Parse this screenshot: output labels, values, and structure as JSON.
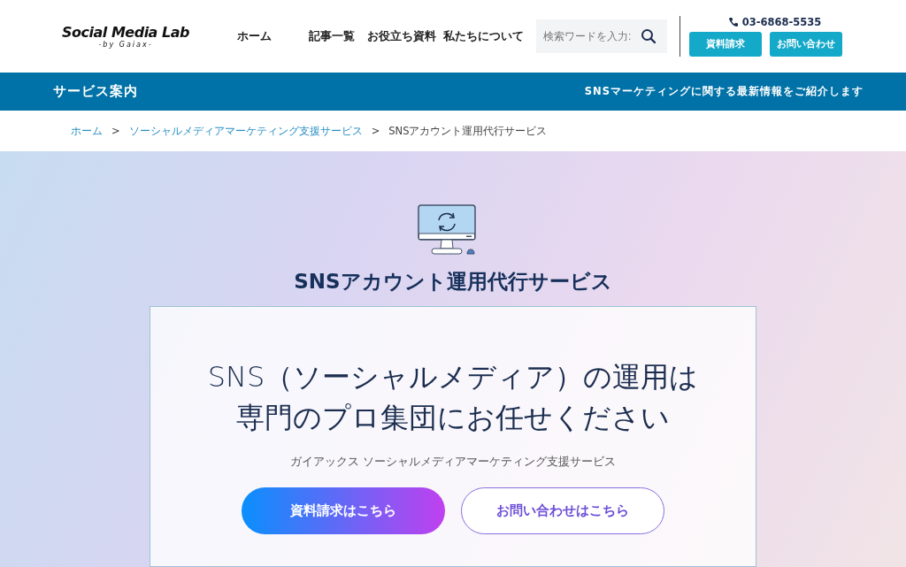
{
  "header": {
    "logo": {
      "title": "Social Media Lab",
      "subtitle": "-by Gaiax-"
    },
    "nav": [
      {
        "label": "ホーム"
      },
      {
        "label": "記事一覧"
      },
      {
        "label": "お役立ち資料"
      },
      {
        "label": "私たちについて"
      }
    ],
    "search": {
      "placeholder": "検索ワードを入力:"
    },
    "phone": "03-6868-5535",
    "buttons": [
      "資料請求",
      "お問い合わせ"
    ]
  },
  "section_bar": {
    "title": "サービス案内",
    "tagline": "SNSマーケティングに関する最新情報をご紹介します"
  },
  "breadcrumb": [
    {
      "label": "ホーム",
      "link": true
    },
    {
      "label": "ソーシャルメディアマーケティング支援サービス",
      "link": true
    },
    {
      "label": "SNSアカウント運用代行サービス",
      "link": false
    }
  ],
  "breadcrumb_separator": ">",
  "hero": {
    "title": "SNSアカウント運用代行サービス",
    "headline": [
      "SNS（ソーシャルメディア）の運用は",
      "専門のプロ集団にお任せください"
    ],
    "subtitle": "ガイアックス ソーシャルメディアマーケティング支援サービス",
    "buttons": [
      {
        "label": "資料請求はこちら",
        "kind": "primary"
      },
      {
        "label": "お問い合わせはこちら",
        "kind": "outline"
      }
    ]
  }
}
